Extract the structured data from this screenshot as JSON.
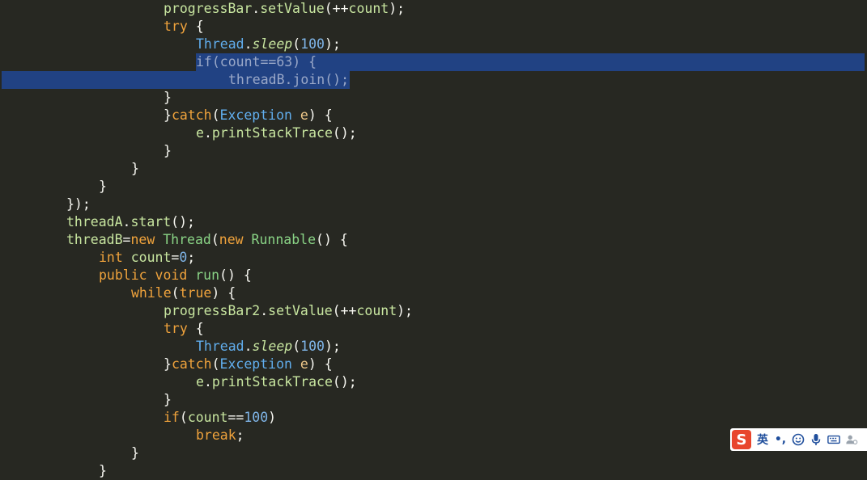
{
  "editor": {
    "selection_color": "#214283",
    "lines": [
      {
        "indent": 202,
        "tokens": [
          [
            "progressBar",
            "t-var"
          ],
          [
            ".",
            "t-plain"
          ],
          [
            "setValue",
            "t-fn"
          ],
          [
            "(++",
            "t-plain"
          ],
          [
            "count",
            "t-var"
          ],
          [
            ");",
            "t-plain"
          ]
        ]
      },
      {
        "indent": 202,
        "tokens": [
          [
            "try",
            "t-kw"
          ],
          [
            " {",
            "t-plain"
          ]
        ]
      },
      {
        "indent": 242,
        "tokens": [
          [
            "Thread",
            "t-type"
          ],
          [
            ".",
            "t-plain"
          ],
          [
            "sleep",
            "t-static"
          ],
          [
            "(",
            "t-plain"
          ],
          [
            "100",
            "t-num"
          ],
          [
            ");",
            "t-plain"
          ]
        ]
      },
      {
        "indent": 242,
        "selected": true,
        "tokens": [
          [
            "if(count==63) {",
            "t-sel"
          ]
        ]
      },
      {
        "indent": 282,
        "selected": true,
        "tokens": [
          [
            "threadB.join();",
            "t-sel"
          ]
        ]
      },
      {
        "indent": 202,
        "tokens": [
          [
            "}",
            "t-plain"
          ]
        ]
      },
      {
        "indent": 202,
        "tokens": [
          [
            "}",
            "t-plain"
          ],
          [
            "catch",
            "t-kw"
          ],
          [
            "(",
            "t-plain"
          ],
          [
            "Exception",
            "t-type"
          ],
          [
            " ",
            "t-plain"
          ],
          [
            "e",
            "t-param"
          ],
          [
            ") {",
            "t-plain"
          ]
        ]
      },
      {
        "indent": 242,
        "tokens": [
          [
            "e",
            "t-var"
          ],
          [
            ".",
            "t-plain"
          ],
          [
            "printStackTrace",
            "t-fn"
          ],
          [
            "();",
            "t-plain"
          ]
        ]
      },
      {
        "indent": 202,
        "tokens": [
          [
            "}",
            "t-plain"
          ]
        ]
      },
      {
        "indent": 162,
        "tokens": [
          [
            "}",
            "t-plain"
          ]
        ]
      },
      {
        "indent": 122,
        "tokens": [
          [
            "}",
            "t-plain"
          ]
        ]
      },
      {
        "indent": 82,
        "tokens": [
          [
            "});",
            "t-plain"
          ]
        ]
      },
      {
        "indent": 82,
        "tokens": [
          [
            "threadA",
            "t-var"
          ],
          [
            ".",
            "t-plain"
          ],
          [
            "start",
            "t-fn"
          ],
          [
            "();",
            "t-plain"
          ]
        ]
      },
      {
        "indent": 82,
        "tokens": [
          [
            "threadB",
            "t-var"
          ],
          [
            "=",
            "t-plain"
          ],
          [
            "new",
            "t-kw"
          ],
          [
            " ",
            "t-plain"
          ],
          [
            "Thread",
            "t-cls"
          ],
          [
            "(",
            "t-plain"
          ],
          [
            "new",
            "t-kw"
          ],
          [
            " ",
            "t-plain"
          ],
          [
            "Runnable",
            "t-cls"
          ],
          [
            "() {",
            "t-plain"
          ]
        ]
      },
      {
        "indent": 122,
        "tokens": [
          [
            "int",
            "t-kw"
          ],
          [
            " ",
            "t-plain"
          ],
          [
            "count",
            "t-var"
          ],
          [
            "=",
            "t-plain"
          ],
          [
            "0",
            "t-num"
          ],
          [
            ";",
            "t-plain"
          ]
        ]
      },
      {
        "indent": 122,
        "tokens": [
          [
            "public",
            "t-kw"
          ],
          [
            " ",
            "t-plain"
          ],
          [
            "void",
            "t-kw"
          ],
          [
            " ",
            "t-plain"
          ],
          [
            "run",
            "t-cls"
          ],
          [
            "() {",
            "t-plain"
          ]
        ]
      },
      {
        "indent": 162,
        "tokens": [
          [
            "while",
            "t-kw"
          ],
          [
            "(",
            "t-plain"
          ],
          [
            "true",
            "t-kw"
          ],
          [
            ") {",
            "t-plain"
          ]
        ]
      },
      {
        "indent": 202,
        "tokens": [
          [
            "progressBar2",
            "t-var"
          ],
          [
            ".",
            "t-plain"
          ],
          [
            "setValue",
            "t-fn"
          ],
          [
            "(++",
            "t-plain"
          ],
          [
            "count",
            "t-var"
          ],
          [
            ");",
            "t-plain"
          ]
        ]
      },
      {
        "indent": 202,
        "tokens": [
          [
            "try",
            "t-kw"
          ],
          [
            " {",
            "t-plain"
          ]
        ]
      },
      {
        "indent": 242,
        "tokens": [
          [
            "Thread",
            "t-type"
          ],
          [
            ".",
            "t-plain"
          ],
          [
            "sleep",
            "t-static"
          ],
          [
            "(",
            "t-plain"
          ],
          [
            "100",
            "t-num"
          ],
          [
            ");",
            "t-plain"
          ]
        ]
      },
      {
        "indent": 202,
        "tokens": [
          [
            "}",
            "t-plain"
          ],
          [
            "catch",
            "t-kw"
          ],
          [
            "(",
            "t-plain"
          ],
          [
            "Exception",
            "t-type"
          ],
          [
            " ",
            "t-plain"
          ],
          [
            "e",
            "t-param"
          ],
          [
            ") {",
            "t-plain"
          ]
        ]
      },
      {
        "indent": 242,
        "tokens": [
          [
            "e",
            "t-var"
          ],
          [
            ".",
            "t-plain"
          ],
          [
            "printStackTrace",
            "t-fn"
          ],
          [
            "();",
            "t-plain"
          ]
        ]
      },
      {
        "indent": 202,
        "tokens": [
          [
            "}",
            "t-plain"
          ]
        ]
      },
      {
        "indent": 202,
        "tokens": [
          [
            "if",
            "t-kw"
          ],
          [
            "(",
            "t-plain"
          ],
          [
            "count",
            "t-var"
          ],
          [
            "==",
            "t-plain"
          ],
          [
            "100",
            "t-num"
          ],
          [
            ")",
            "t-plain"
          ]
        ]
      },
      {
        "indent": 242,
        "tokens": [
          [
            "break",
            "t-kw"
          ],
          [
            ";",
            "t-plain"
          ]
        ]
      },
      {
        "indent": 162,
        "tokens": [
          [
            "}",
            "t-plain"
          ]
        ]
      },
      {
        "indent": 122,
        "tokens": [
          [
            "}",
            "t-plain"
          ]
        ]
      }
    ]
  },
  "ime": {
    "logo_text": "S",
    "mode_label": "英",
    "punct_label": "•,",
    "icons": [
      "logo-icon",
      "smiley-icon",
      "microphone-icon",
      "keyboard-icon",
      "user-settings-icon"
    ]
  }
}
